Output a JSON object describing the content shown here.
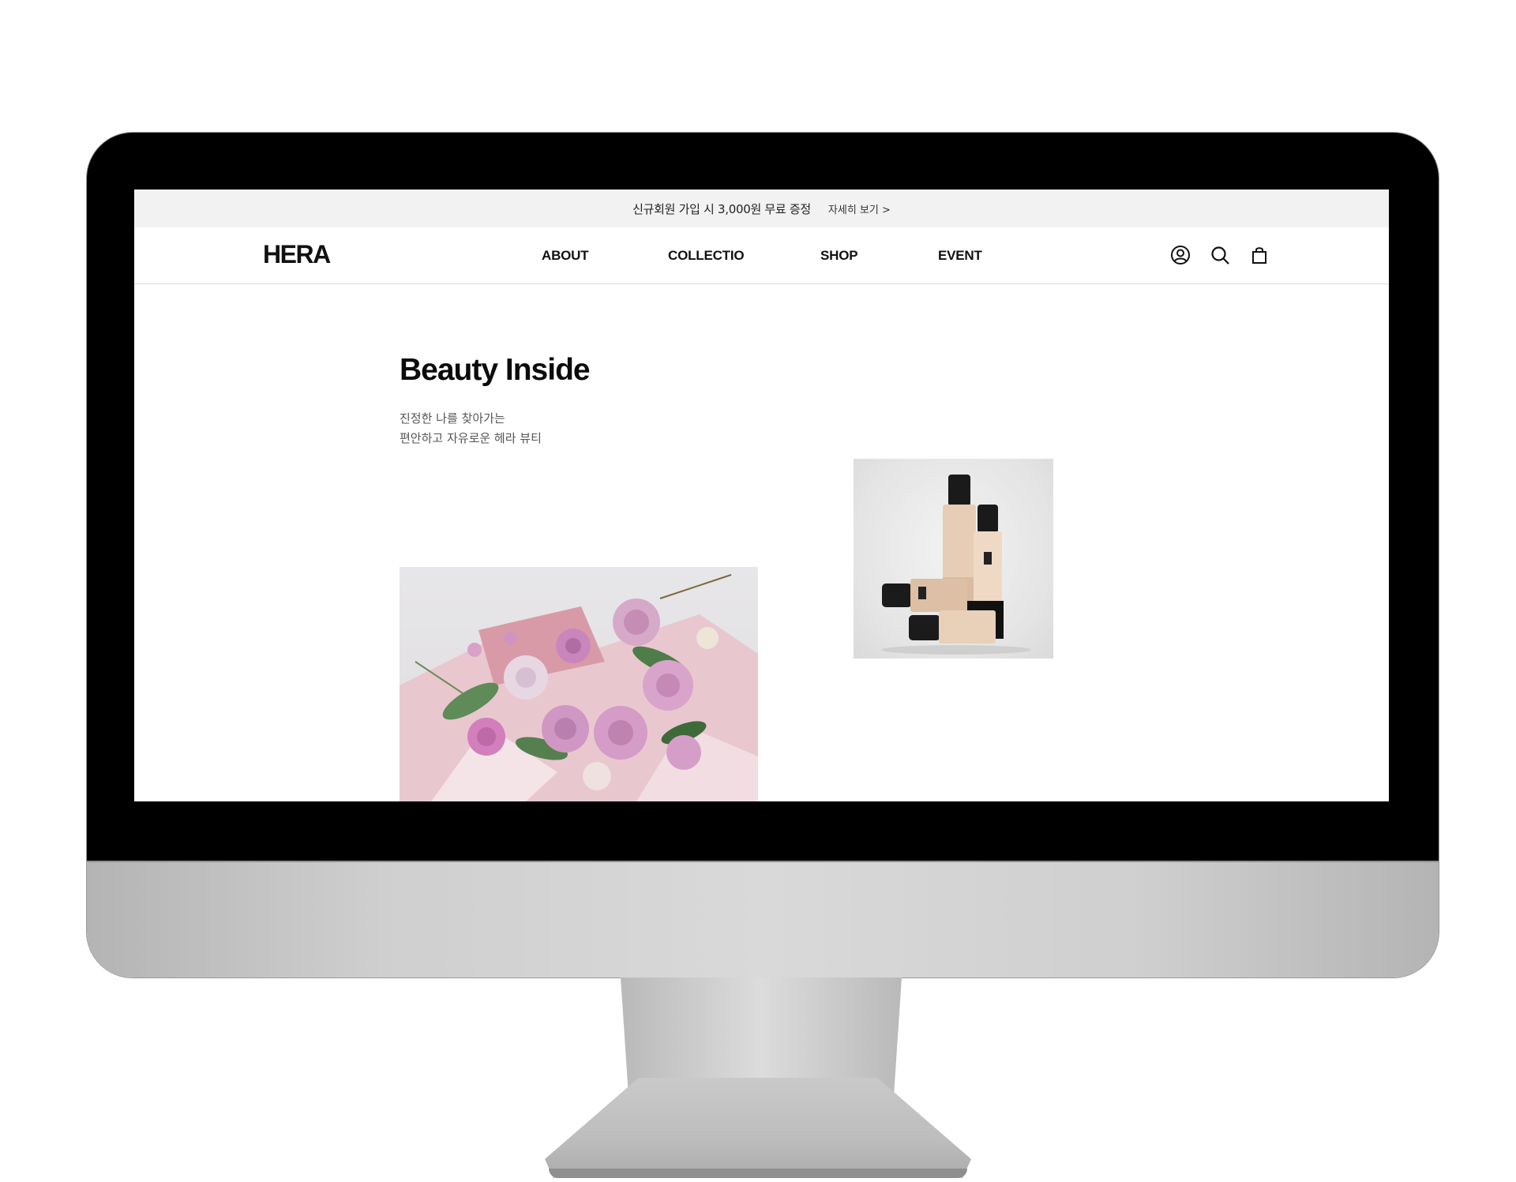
{
  "promo": {
    "text": "신규회원 가입 시 3,000원 무료 증정",
    "link": "자세히 보기 >"
  },
  "header": {
    "logo": "HERA",
    "nav": [
      "ABOUT",
      "COLLECTIO",
      "SHOP",
      "EVENT"
    ],
    "icons": [
      "user-icon",
      "search-icon",
      "shopping-bag-icon"
    ]
  },
  "hero": {
    "title": "Beauty Inside",
    "subtitle_lines": [
      "진정한 나를 찾아가는",
      "편안하고 자유로운 헤라 뷰티"
    ]
  },
  "images": {
    "flower": "pink-rose-bouquet-image",
    "product": "foundation-bottles-image"
  }
}
